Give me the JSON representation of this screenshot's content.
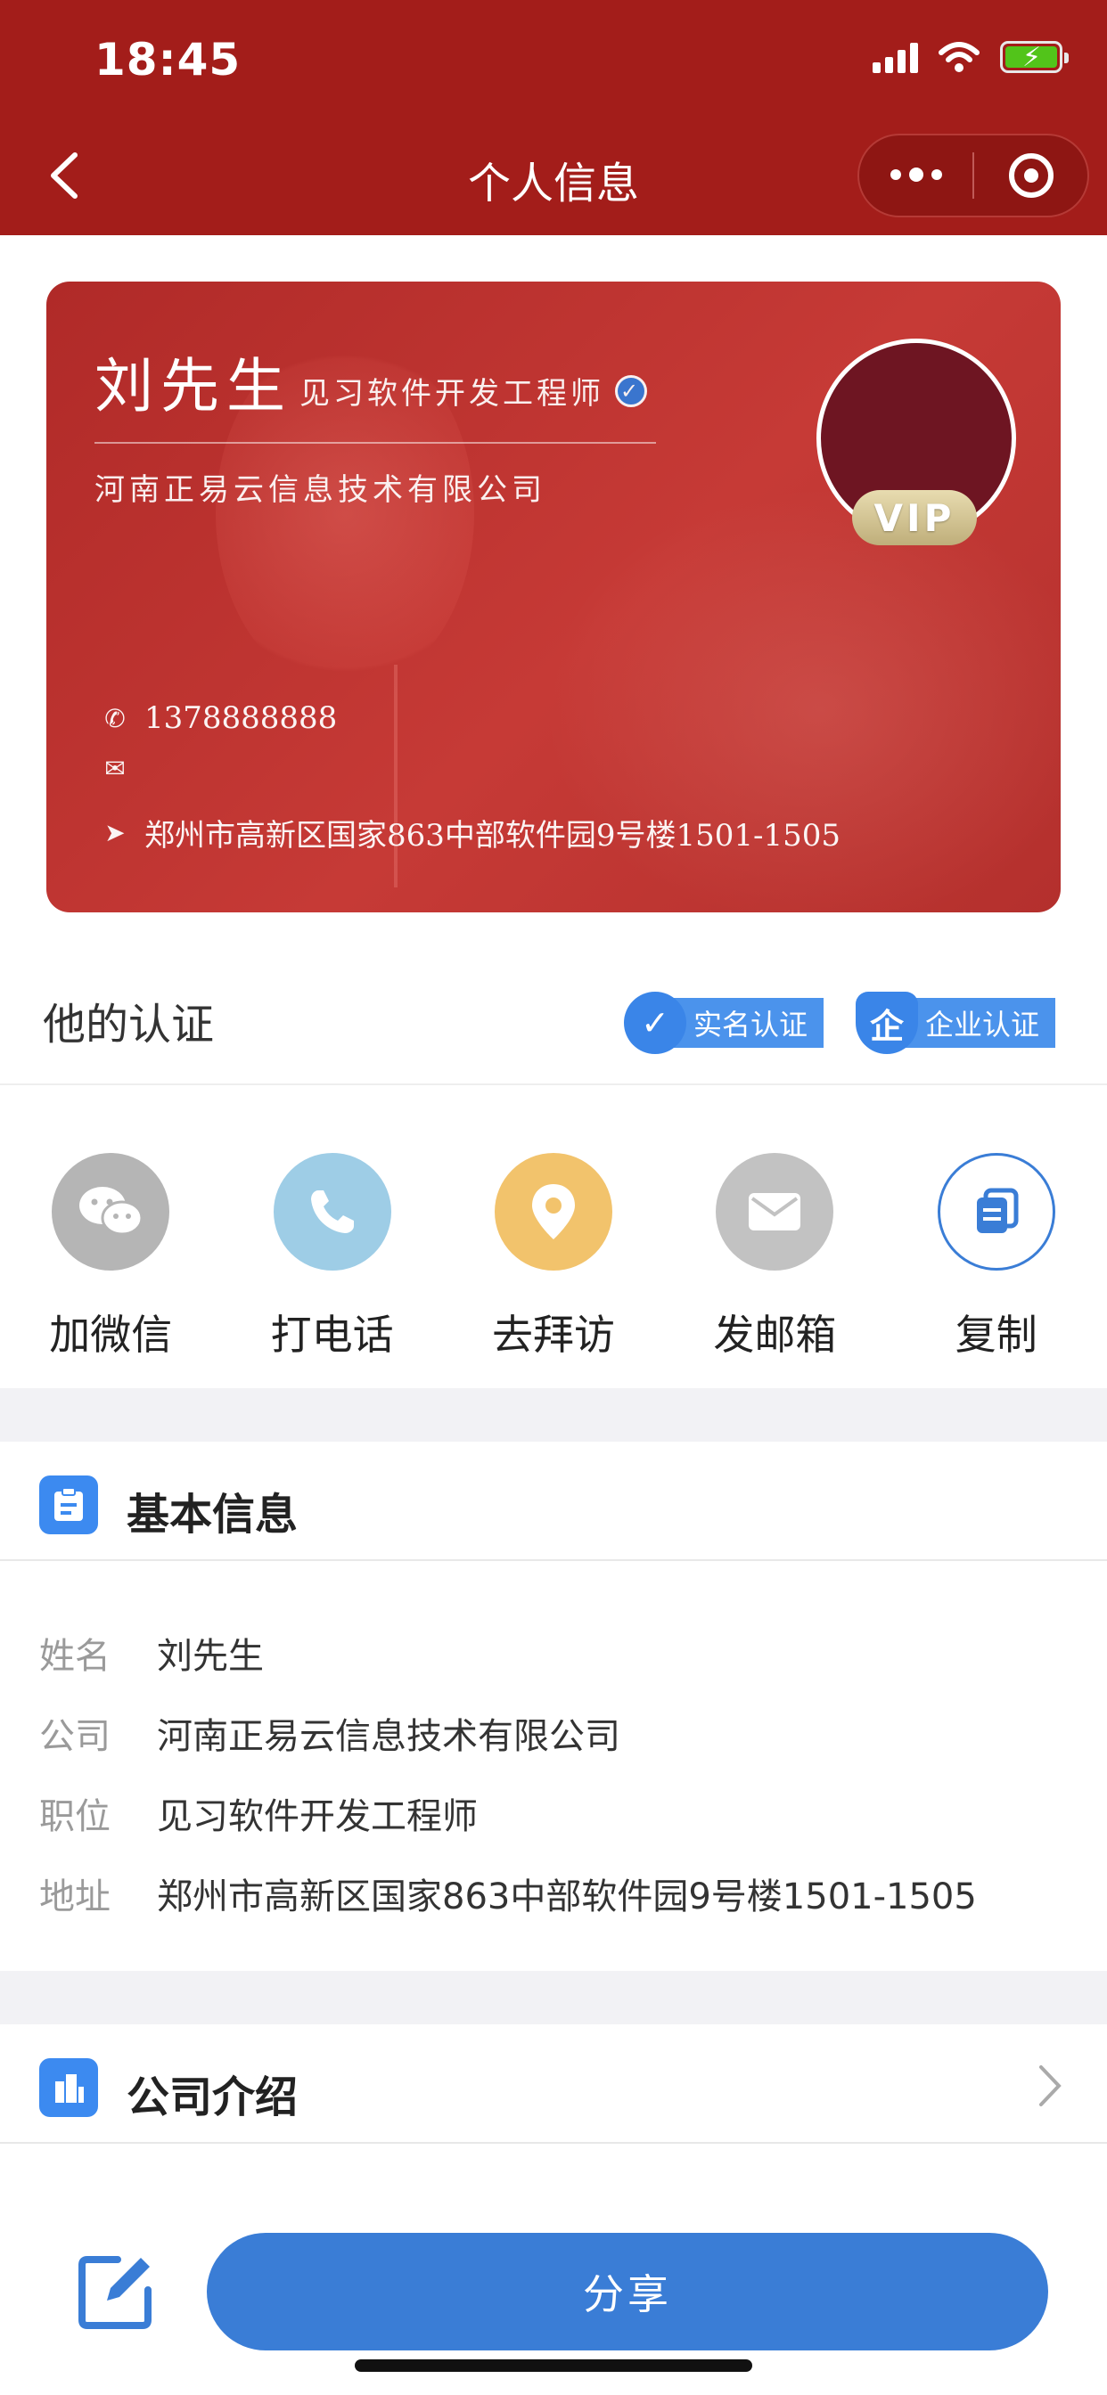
{
  "status": {
    "time": "18:45"
  },
  "nav": {
    "title": "个人信息"
  },
  "card": {
    "name": "刘先生",
    "position": "见习软件开发工程师",
    "company": "河南正易云信息技术有限公司",
    "phone": "1378888888",
    "email": "",
    "address": "郑州市高新区国家863中部软件园9号楼1501-1505",
    "vip": "VIP"
  },
  "cert": {
    "title": "他的认证",
    "real_name": "实名认证",
    "enterprise": "企业认证",
    "enterprise_glyph": "企"
  },
  "actions": [
    {
      "label": "加微信",
      "icon": "wechat-icon",
      "color": "#b5b5b5"
    },
    {
      "label": "打电话",
      "icon": "phone-icon",
      "color": "#9ecde6"
    },
    {
      "label": "去拜访",
      "icon": "location-icon",
      "color": "#f2c36c"
    },
    {
      "label": "发邮箱",
      "icon": "mail-icon",
      "color": "#c2c2c2"
    },
    {
      "label": "复制",
      "icon": "copy-icon",
      "color": "#ffffff"
    }
  ],
  "basic": {
    "title": "基本信息",
    "rows": [
      {
        "key": "姓名",
        "value": "刘先生"
      },
      {
        "key": "公司",
        "value": "河南正易云信息技术有限公司"
      },
      {
        "key": "职位",
        "value": "见习软件开发工程师"
      },
      {
        "key": "地址",
        "value": "郑州市高新区国家863中部软件园9号楼1501-1505"
      }
    ]
  },
  "company_intro": {
    "title": "公司介绍"
  },
  "bottom": {
    "share_label": "分享"
  }
}
